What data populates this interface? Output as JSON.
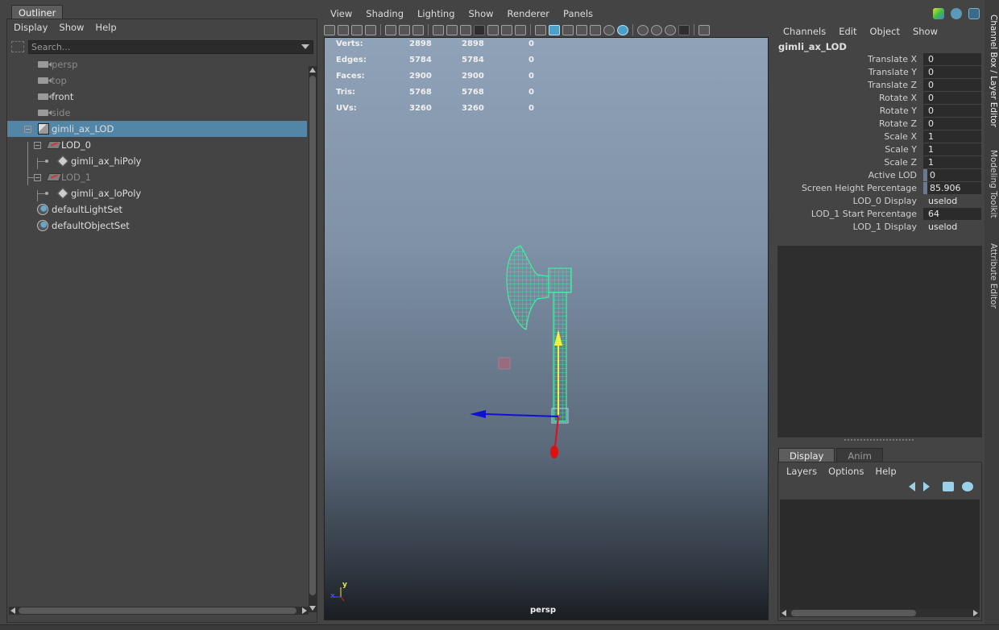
{
  "outliner": {
    "tab_label": "Outliner",
    "menu": [
      "Display",
      "Show",
      "Help"
    ],
    "search_placeholder": "Search...",
    "items": [
      {
        "label": "persp",
        "icon": "camera-icon",
        "dim": true
      },
      {
        "label": "top",
        "icon": "camera-icon",
        "dim": true
      },
      {
        "label": "front",
        "icon": "camera-icon",
        "dim": false
      },
      {
        "label": "side",
        "icon": "camera-icon",
        "dim": true
      },
      {
        "label": "gimli_ax_LOD",
        "icon": "lod-group-icon",
        "selected": true
      },
      {
        "label": "LOD_0",
        "icon": "transform-group-icon",
        "dim": false
      },
      {
        "label": "gimli_ax_hiPoly",
        "icon": "mesh-icon",
        "dim": false
      },
      {
        "label": "LOD_1",
        "icon": "transform-group-icon",
        "dim": true
      },
      {
        "label": "gimli_ax_loPoly",
        "icon": "mesh-icon",
        "dim": false
      },
      {
        "label": "defaultLightSet",
        "icon": "set-icon",
        "dim": false
      },
      {
        "label": "defaultObjectSet",
        "icon": "set-icon",
        "dim": false
      }
    ]
  },
  "viewport": {
    "menu": [
      "View",
      "Shading",
      "Lighting",
      "Show",
      "Renderer",
      "Panels"
    ],
    "camera_label": "persp",
    "hud": [
      {
        "label": "Verts:",
        "c1": "2898",
        "c2": "2898",
        "c3": "0"
      },
      {
        "label": "Edges:",
        "c1": "5784",
        "c2": "5784",
        "c3": "0"
      },
      {
        "label": "Faces:",
        "c1": "2900",
        "c2": "2900",
        "c3": "0"
      },
      {
        "label": "Tris:",
        "c1": "5768",
        "c2": "5768",
        "c3": "0"
      },
      {
        "label": "UVs:",
        "c1": "3260",
        "c2": "3260",
        "c3": "0"
      }
    ],
    "axis_y": "y",
    "axis_x": "x",
    "colors": {
      "wireframe": "#40f0a0",
      "manip_y": "#f0f040",
      "manip_x": "#1010d0",
      "manip_z": "#e01010"
    }
  },
  "channel_box": {
    "menu": [
      "Channels",
      "Edit",
      "Object",
      "Show"
    ],
    "object_name": "gimli_ax_LOD",
    "attributes": [
      {
        "name": "Translate X",
        "value": "0"
      },
      {
        "name": "Translate Y",
        "value": "0"
      },
      {
        "name": "Translate Z",
        "value": "0"
      },
      {
        "name": "Rotate X",
        "value": "0"
      },
      {
        "name": "Rotate Y",
        "value": "0"
      },
      {
        "name": "Rotate Z",
        "value": "0"
      },
      {
        "name": "Scale X",
        "value": "1"
      },
      {
        "name": "Scale Y",
        "value": "1"
      },
      {
        "name": "Scale Z",
        "value": "1"
      },
      {
        "name": "Active LOD",
        "value": "0"
      },
      {
        "name": "Screen Height Percentage",
        "value": "85.906"
      },
      {
        "name": "LOD_0 Display",
        "value": "uselod"
      },
      {
        "name": "LOD_1 Start Percentage",
        "value": "64"
      },
      {
        "name": "LOD_1 Display",
        "value": "uselod"
      }
    ]
  },
  "side_tabs": [
    "Channel Box / Layer Editor",
    "Modeling Toolkit",
    "Attribute Editor"
  ],
  "layer_editor": {
    "tabs": [
      "Display",
      "Anim"
    ],
    "menu": [
      "Layers",
      "Options",
      "Help"
    ]
  }
}
